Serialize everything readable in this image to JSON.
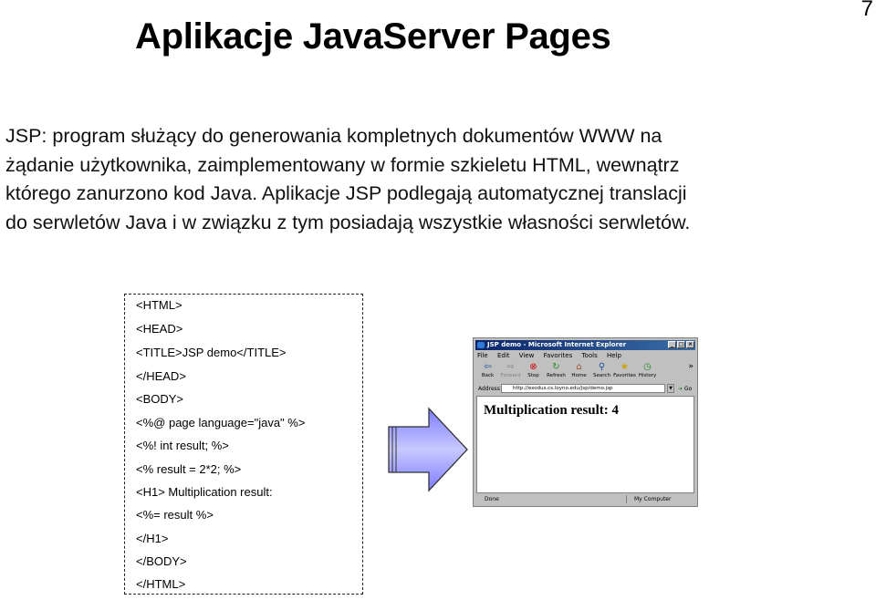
{
  "slide": {
    "number": "7",
    "title": "Aplikacje JavaServer Pages",
    "paragraph_lines": [
      "JSP: program służący do generowania kompletnych dokumentów WWW na",
      "żądanie użytkownika, zaimplementowany w formie szkieletu HTML, wewnątrz",
      "którego zanurzono kod Java. Aplikacje JSP podlegają automatycznej translacji",
      "do serwletów Java i w związku z tym posiadają wszystkie własności serwletów."
    ]
  },
  "code": {
    "lines": [
      "<HTML>",
      "<HEAD>",
      "<TITLE>JSP demo</TITLE>",
      "</HEAD>",
      "<BODY>",
      "<%@ page language=\"java\" %>",
      "<%! int result; %>",
      "<% result = 2*2; %>",
      "<H1> Multiplication result:",
      "<%= result %>",
      "</H1>",
      "</BODY>",
      "</HTML>"
    ]
  },
  "arrow": {
    "fill_color": "#9999ff",
    "edge_color": "#333333"
  },
  "browser": {
    "window_title": "JSP demo - Microsoft Internet Explorer",
    "menu": [
      "File",
      "Edit",
      "View",
      "Favorites",
      "Tools",
      "Help"
    ],
    "toolbar": [
      {
        "label": "Back",
        "icon": "back-arrow-icon"
      },
      {
        "label": "Forward",
        "icon": "forward-arrow-icon"
      },
      {
        "label": "Stop",
        "icon": "stop-icon"
      },
      {
        "label": "Refresh",
        "icon": "refresh-icon"
      },
      {
        "label": "Home",
        "icon": "home-icon"
      },
      {
        "label": "Search",
        "icon": "search-icon"
      },
      {
        "label": "Favorites",
        "icon": "favorites-icon"
      },
      {
        "label": "History",
        "icon": "history-icon"
      }
    ],
    "address_label": "Address",
    "address_url": "http://exodus.cs.loyno.edu/jsp/demo.jsp",
    "go_label": "Go",
    "page_heading": "Multiplication result: 4",
    "status_left": "Done",
    "status_right": "My Computer"
  }
}
